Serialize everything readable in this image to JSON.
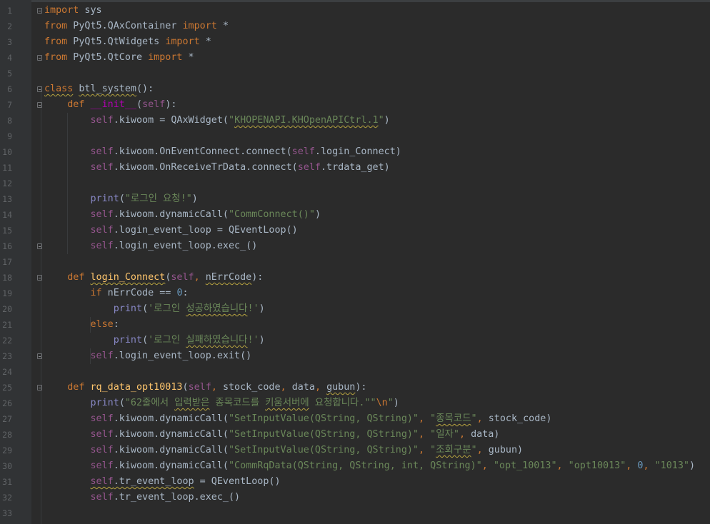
{
  "editor": {
    "colors": {
      "background": "#2b2b2b",
      "gutter": "#313335",
      "line_number": "#606366",
      "keyword": "#cc7832",
      "self": "#94558d",
      "string": "#6a8759",
      "number": "#6897bb",
      "function_name": "#ffc66d",
      "magic_method": "#b200b2",
      "builtin": "#8888c6",
      "text": "#a9b7c6"
    },
    "lines": [
      {
        "num": "1",
        "fold": true,
        "tokens": [
          {
            "t": "import",
            "c": "kw"
          },
          {
            "t": " sys",
            "c": "plain"
          }
        ]
      },
      {
        "num": "2",
        "tokens": [
          {
            "t": "from",
            "c": "kw"
          },
          {
            "t": " PyQt5.QAxContainer ",
            "c": "plain"
          },
          {
            "t": "import",
            "c": "kw"
          },
          {
            "t": " *",
            "c": "plain"
          }
        ]
      },
      {
        "num": "3",
        "tokens": [
          {
            "t": "from",
            "c": "kw"
          },
          {
            "t": " PyQt5.QtWidgets ",
            "c": "plain"
          },
          {
            "t": "import",
            "c": "kw"
          },
          {
            "t": " *",
            "c": "plain"
          }
        ]
      },
      {
        "num": "4",
        "fold": true,
        "tokens": [
          {
            "t": "from",
            "c": "kw"
          },
          {
            "t": " PyQt5.QtCore ",
            "c": "plain"
          },
          {
            "t": "import",
            "c": "kw"
          },
          {
            "t": " *",
            "c": "plain"
          }
        ]
      },
      {
        "num": "5",
        "tokens": []
      },
      {
        "num": "6",
        "fold": true,
        "tokens": [
          {
            "t": "class",
            "c": "kw-wavy"
          },
          {
            "t": " ",
            "c": "plain"
          },
          {
            "t": "btl_system",
            "c": "plain-wavy"
          },
          {
            "t": "():",
            "c": "plain"
          }
        ]
      },
      {
        "num": "7",
        "fold": true,
        "tokens": [
          {
            "t": "    ",
            "c": "plain"
          },
          {
            "t": "def",
            "c": "kw"
          },
          {
            "t": " ",
            "c": "plain"
          },
          {
            "t": "__init__",
            "c": "magic"
          },
          {
            "t": "(",
            "c": "plain"
          },
          {
            "t": "self",
            "c": "self"
          },
          {
            "t": "):",
            "c": "plain"
          }
        ]
      },
      {
        "num": "8",
        "tokens": [
          {
            "t": "        ",
            "c": "plain"
          },
          {
            "t": "self",
            "c": "self"
          },
          {
            "t": ".kiwoom = QAxWidget(",
            "c": "plain"
          },
          {
            "t": "\"",
            "c": "str"
          },
          {
            "t": "KHOPENAPI.KHOpenAPICtrl.1",
            "c": "str-wavy"
          },
          {
            "t": "\"",
            "c": "str"
          },
          {
            "t": ")",
            "c": "plain"
          }
        ]
      },
      {
        "num": "9",
        "tokens": []
      },
      {
        "num": "10",
        "tokens": [
          {
            "t": "        ",
            "c": "plain"
          },
          {
            "t": "self",
            "c": "self"
          },
          {
            "t": ".kiwoom.OnEventConnect.connect(",
            "c": "plain"
          },
          {
            "t": "self",
            "c": "self"
          },
          {
            "t": ".login_Connect)",
            "c": "plain"
          }
        ]
      },
      {
        "num": "11",
        "tokens": [
          {
            "t": "        ",
            "c": "plain"
          },
          {
            "t": "self",
            "c": "self"
          },
          {
            "t": ".kiwoom.OnReceiveTrData.connect(",
            "c": "plain"
          },
          {
            "t": "self",
            "c": "self"
          },
          {
            "t": ".trdata_get)",
            "c": "plain"
          }
        ]
      },
      {
        "num": "12",
        "tokens": []
      },
      {
        "num": "13",
        "tokens": [
          {
            "t": "        ",
            "c": "plain"
          },
          {
            "t": "print",
            "c": "builtin"
          },
          {
            "t": "(",
            "c": "plain"
          },
          {
            "t": "\"로그인 요청!\"",
            "c": "str"
          },
          {
            "t": ")",
            "c": "plain"
          }
        ]
      },
      {
        "num": "14",
        "tokens": [
          {
            "t": "        ",
            "c": "plain"
          },
          {
            "t": "self",
            "c": "self"
          },
          {
            "t": ".kiwoom.dynamicCall(",
            "c": "plain"
          },
          {
            "t": "\"CommConnect()\"",
            "c": "str"
          },
          {
            "t": ")",
            "c": "plain"
          }
        ]
      },
      {
        "num": "15",
        "tokens": [
          {
            "t": "        ",
            "c": "plain"
          },
          {
            "t": "self",
            "c": "self"
          },
          {
            "t": ".login_event_loop = QEventLoop()",
            "c": "plain"
          }
        ]
      },
      {
        "num": "16",
        "fold": true,
        "tokens": [
          {
            "t": "        ",
            "c": "plain"
          },
          {
            "t": "self",
            "c": "self"
          },
          {
            "t": ".login_event_loop.exec_()",
            "c": "plain"
          }
        ]
      },
      {
        "num": "17",
        "tokens": []
      },
      {
        "num": "18",
        "fold": true,
        "tokens": [
          {
            "t": "    ",
            "c": "plain"
          },
          {
            "t": "def",
            "c": "kw"
          },
          {
            "t": " ",
            "c": "plain"
          },
          {
            "t": "login_Connect",
            "c": "fn-wavy"
          },
          {
            "t": "(",
            "c": "plain"
          },
          {
            "t": "self",
            "c": "self"
          },
          {
            "t": ", ",
            "c": "kw"
          },
          {
            "t": "nErrCode",
            "c": "param-wavy"
          },
          {
            "t": "):",
            "c": "plain"
          }
        ]
      },
      {
        "num": "19",
        "tokens": [
          {
            "t": "        ",
            "c": "plain"
          },
          {
            "t": "if",
            "c": "kw"
          },
          {
            "t": " nErrCode == ",
            "c": "plain"
          },
          {
            "t": "0",
            "c": "num"
          },
          {
            "t": ":",
            "c": "plain"
          }
        ]
      },
      {
        "num": "20",
        "tokens": [
          {
            "t": "            ",
            "c": "plain"
          },
          {
            "t": "print",
            "c": "builtin"
          },
          {
            "t": "(",
            "c": "plain"
          },
          {
            "t": "'로그인 ",
            "c": "str"
          },
          {
            "t": "성공하였습니다",
            "c": "str-wavy"
          },
          {
            "t": "!'",
            "c": "str"
          },
          {
            "t": ")",
            "c": "plain"
          }
        ]
      },
      {
        "num": "21",
        "tokens": [
          {
            "t": "        ",
            "c": "plain"
          },
          {
            "t": "else",
            "c": "kw"
          },
          {
            "t": ":",
            "c": "plain"
          }
        ]
      },
      {
        "num": "22",
        "tokens": [
          {
            "t": "            ",
            "c": "plain"
          },
          {
            "t": "print",
            "c": "builtin"
          },
          {
            "t": "(",
            "c": "plain"
          },
          {
            "t": "'로그인 ",
            "c": "str"
          },
          {
            "t": "실패하였습니다",
            "c": "str-wavy"
          },
          {
            "t": "!'",
            "c": "str"
          },
          {
            "t": ")",
            "c": "plain"
          }
        ]
      },
      {
        "num": "23",
        "fold": true,
        "tokens": [
          {
            "t": "        ",
            "c": "plain"
          },
          {
            "t": "self",
            "c": "self"
          },
          {
            "t": ".login_event_loop.exit()",
            "c": "plain"
          }
        ]
      },
      {
        "num": "24",
        "tokens": []
      },
      {
        "num": "25",
        "fold": true,
        "tokens": [
          {
            "t": "    ",
            "c": "plain"
          },
          {
            "t": "def",
            "c": "kw"
          },
          {
            "t": " ",
            "c": "plain"
          },
          {
            "t": "rq_data_opt10013",
            "c": "fn"
          },
          {
            "t": "(",
            "c": "plain"
          },
          {
            "t": "self",
            "c": "self"
          },
          {
            "t": ", ",
            "c": "kw"
          },
          {
            "t": "stock_code",
            "c": "plain"
          },
          {
            "t": ", ",
            "c": "kw"
          },
          {
            "t": "data",
            "c": "plain"
          },
          {
            "t": ", ",
            "c": "kw"
          },
          {
            "t": "gubun",
            "c": "param-wavy"
          },
          {
            "t": "):",
            "c": "plain"
          }
        ]
      },
      {
        "num": "26",
        "tokens": [
          {
            "t": "        ",
            "c": "plain"
          },
          {
            "t": "print",
            "c": "builtin"
          },
          {
            "t": "(",
            "c": "plain"
          },
          {
            "t": "\"62줄에서 ",
            "c": "str"
          },
          {
            "t": "입력받은",
            "c": "str-wavy"
          },
          {
            "t": " 종목코드를 ",
            "c": "str"
          },
          {
            "t": "키움서버에",
            "c": "str-wavy"
          },
          {
            "t": " 요청합니다.\"\"",
            "c": "str"
          },
          {
            "t": "\\n",
            "c": "esc"
          },
          {
            "t": "\"",
            "c": "str"
          },
          {
            "t": ")",
            "c": "plain"
          }
        ]
      },
      {
        "num": "27",
        "tokens": [
          {
            "t": "        ",
            "c": "plain"
          },
          {
            "t": "self",
            "c": "self"
          },
          {
            "t": ".kiwoom.dynamicCall(",
            "c": "plain"
          },
          {
            "t": "\"SetInputValue(QString, QString)\"",
            "c": "str"
          },
          {
            "t": ", ",
            "c": "kw"
          },
          {
            "t": "\"",
            "c": "str"
          },
          {
            "t": "종목코드",
            "c": "str-wavy"
          },
          {
            "t": "\"",
            "c": "str"
          },
          {
            "t": ", ",
            "c": "kw"
          },
          {
            "t": "stock_code)",
            "c": "plain"
          }
        ]
      },
      {
        "num": "28",
        "tokens": [
          {
            "t": "        ",
            "c": "plain"
          },
          {
            "t": "self",
            "c": "self"
          },
          {
            "t": ".kiwoom.dynamicCall(",
            "c": "plain"
          },
          {
            "t": "\"SetInputValue(QString, QString)\"",
            "c": "str"
          },
          {
            "t": ", ",
            "c": "kw"
          },
          {
            "t": "\"일자\"",
            "c": "str"
          },
          {
            "t": ", ",
            "c": "kw"
          },
          {
            "t": "data)",
            "c": "plain"
          }
        ]
      },
      {
        "num": "29",
        "tokens": [
          {
            "t": "        ",
            "c": "plain"
          },
          {
            "t": "self",
            "c": "self"
          },
          {
            "t": ".kiwoom.dynamicCall(",
            "c": "plain"
          },
          {
            "t": "\"SetInputValue(QString, QString)\"",
            "c": "str"
          },
          {
            "t": ", ",
            "c": "kw"
          },
          {
            "t": "\"",
            "c": "str"
          },
          {
            "t": "조회구분",
            "c": "str-wavy"
          },
          {
            "t": "\"",
            "c": "str"
          },
          {
            "t": ", ",
            "c": "kw"
          },
          {
            "t": "gubun)",
            "c": "plain"
          }
        ]
      },
      {
        "num": "30",
        "tokens": [
          {
            "t": "        ",
            "c": "plain"
          },
          {
            "t": "self",
            "c": "self"
          },
          {
            "t": ".kiwoom.dynamicCall(",
            "c": "plain"
          },
          {
            "t": "\"CommRqData(QString, QString, int, QString)\"",
            "c": "str"
          },
          {
            "t": ", ",
            "c": "kw"
          },
          {
            "t": "\"opt_10013\"",
            "c": "str"
          },
          {
            "t": ", ",
            "c": "kw"
          },
          {
            "t": "\"opt10013\"",
            "c": "str"
          },
          {
            "t": ", ",
            "c": "kw"
          },
          {
            "t": "0",
            "c": "num"
          },
          {
            "t": ", ",
            "c": "kw"
          },
          {
            "t": "\"1013\"",
            "c": "str"
          },
          {
            "t": ")",
            "c": "plain"
          }
        ]
      },
      {
        "num": "31",
        "tokens": [
          {
            "t": "        ",
            "c": "plain"
          },
          {
            "t": "self",
            "c": "self-wavy"
          },
          {
            "t": ".tr_event_loop",
            "c": "plain-wavy"
          },
          {
            "t": " = QEventLoop()",
            "c": "plain"
          }
        ]
      },
      {
        "num": "32",
        "tokens": [
          {
            "t": "        ",
            "c": "plain"
          },
          {
            "t": "self",
            "c": "self"
          },
          {
            "t": ".tr_event_loop.exec_()",
            "c": "plain"
          }
        ]
      },
      {
        "num": "33",
        "tokens": []
      }
    ]
  }
}
